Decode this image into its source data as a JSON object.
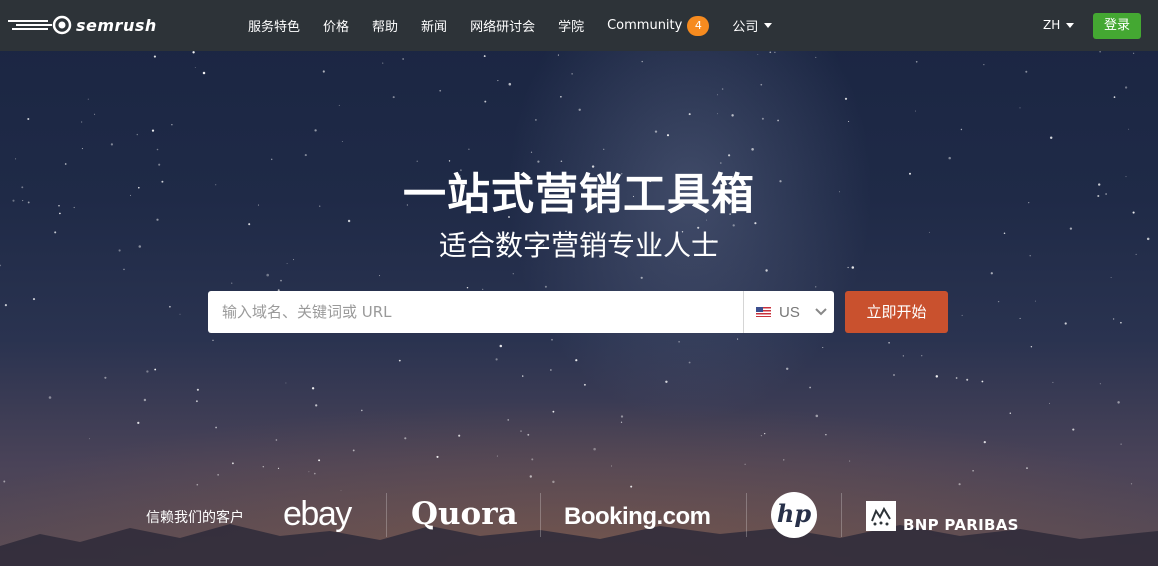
{
  "header": {
    "logo_text": "semrush",
    "nav": [
      {
        "label": "服务特色"
      },
      {
        "label": "价格"
      },
      {
        "label": "帮助"
      },
      {
        "label": "新闻"
      },
      {
        "label": "网络研讨会"
      },
      {
        "label": "学院"
      },
      {
        "label": "Community",
        "badge": "4"
      },
      {
        "label": "公司"
      }
    ],
    "language": "ZH",
    "login_label": "登录"
  },
  "hero": {
    "title": "一站式营销工具箱",
    "subtitle": "适合数字营销专业人士"
  },
  "search": {
    "placeholder": "输入域名、关键词或 URL",
    "value": "",
    "country": "US",
    "button_label": "立即开始"
  },
  "clients": {
    "label": "信赖我们的客户",
    "brands": [
      "ebay",
      "Quora",
      "Booking.com",
      "hp",
      "BNP PARIBAS"
    ]
  },
  "colors": {
    "header_bg": "#2d3338",
    "login_button": "#44a832",
    "start_button": "#c9512e",
    "community_badge": "#f68b1f"
  }
}
